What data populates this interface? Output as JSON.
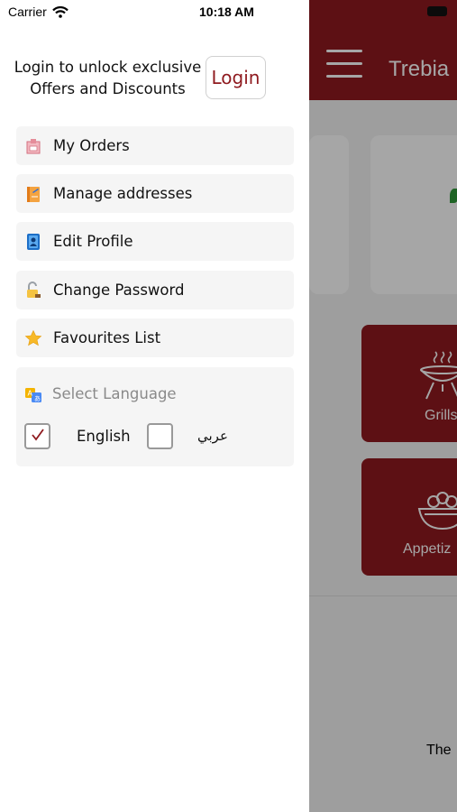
{
  "status_bar": {
    "carrier": "Carrier",
    "time": "10:18 AM"
  },
  "app_background": {
    "title": "Trebia",
    "categories": [
      {
        "label": "Grills"
      },
      {
        "label": "Appetiz"
      }
    ],
    "bottom_text": "The",
    "header_color": "#8f1a1f"
  },
  "drawer": {
    "login_prompt": "Login to unlock exclusive Offers and Discounts",
    "login_button": "Login",
    "menu": [
      {
        "label": "My Orders",
        "icon": "orders-icon"
      },
      {
        "label": "Manage addresses",
        "icon": "address-book-icon"
      },
      {
        "label": "Edit Profile",
        "icon": "profile-contact-icon"
      },
      {
        "label": "Change Password",
        "icon": "unlock-icon"
      },
      {
        "label": "Favourites List",
        "icon": "star-icon"
      }
    ],
    "language": {
      "title": "Select Language",
      "options": [
        {
          "label": "English",
          "checked": true
        },
        {
          "label": "عربي",
          "checked": false
        }
      ]
    }
  },
  "colors": {
    "accent": "#8f1a1f",
    "item_bg": "#f5f5f5"
  }
}
